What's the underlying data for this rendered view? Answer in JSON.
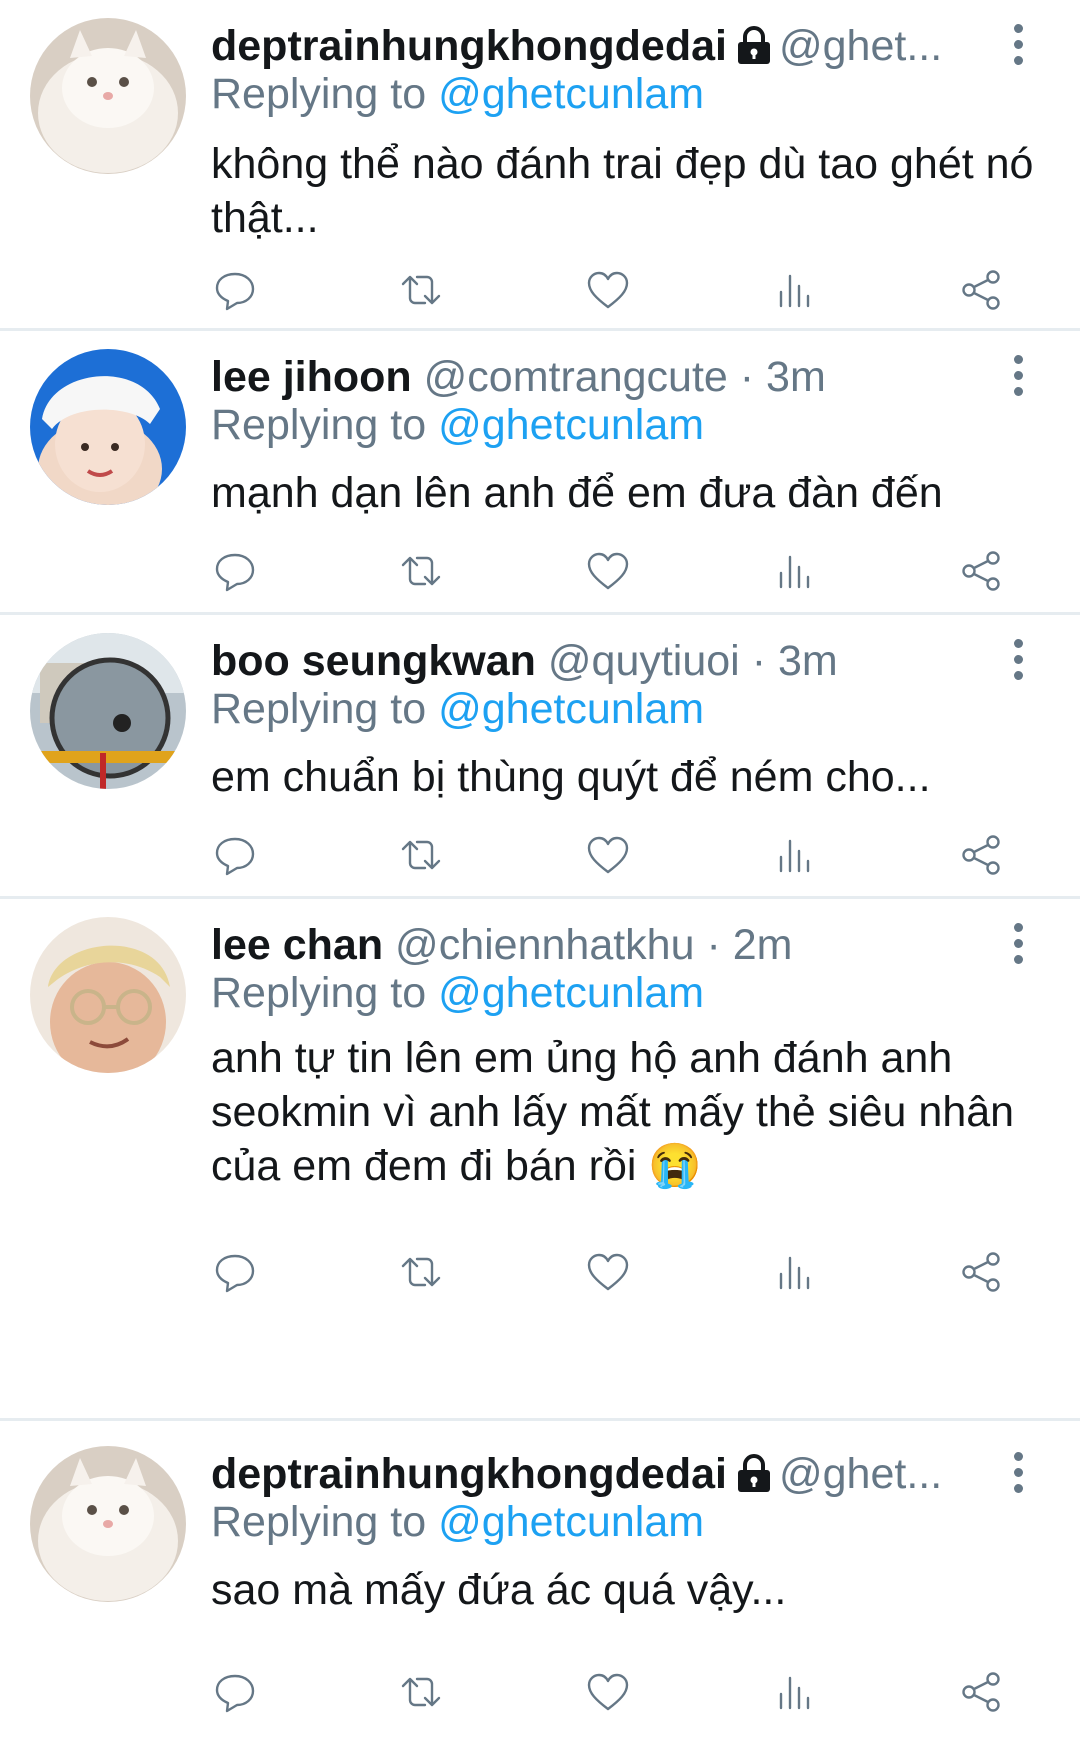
{
  "tweets": [
    {
      "name": "deptrainhungkhongdedai",
      "locked": true,
      "handle": "@ghet...",
      "meta": "",
      "reply_prefix": "Replying to",
      "reply_to": "@ghetcunlam",
      "text": "không thể nào đánh trai đẹp dù tao ghét nó thật...",
      "avatar": "white-cat-avatar"
    },
    {
      "name": "lee jihoon",
      "locked": false,
      "handle": "@comtrangcute",
      "meta": "· 3m",
      "reply_prefix": "Replying to",
      "reply_to": "@ghetcunlam",
      "text": "mạnh dạn lên anh để em đưa đàn đến",
      "avatar": "santa-hat-avatar"
    },
    {
      "name": "boo seungkwan",
      "locked": false,
      "handle": "@quytiuoi",
      "meta": "· 3m",
      "reply_prefix": "Replying to",
      "reply_to": "@ghetcunlam",
      "text": "em chuẩn bị thùng quýt để ném cho...",
      "avatar": "mirror-photo-avatar"
    },
    {
      "name": "lee chan",
      "locked": false,
      "handle": "@chiennhatkhu",
      "meta": "· 2m",
      "reply_prefix": "Replying to",
      "reply_to": "@ghetcunlam",
      "text": "anh tự tin lên em ủng hộ anh đánh anh seokmin vì anh lấy mất mấy thẻ siêu nhân của em đem đi bán rồi 😭",
      "avatar": "glasses-avatar"
    },
    {
      "name": "deptrainhungkhongdedai",
      "locked": true,
      "handle": "@ghet...",
      "meta": "",
      "reply_prefix": "Replying to",
      "reply_to": "@ghetcunlam",
      "text": "sao mà mấy đứa ác quá vậy...",
      "avatar": "white-cat-avatar"
    }
  ],
  "action_icons": [
    "reply-icon",
    "retweet-icon",
    "like-icon",
    "analytics-icon",
    "share-icon"
  ],
  "colors": {
    "link": "#1da1f2",
    "muted": "#657786",
    "text": "#14171a",
    "divider": "#e6ecf0"
  }
}
